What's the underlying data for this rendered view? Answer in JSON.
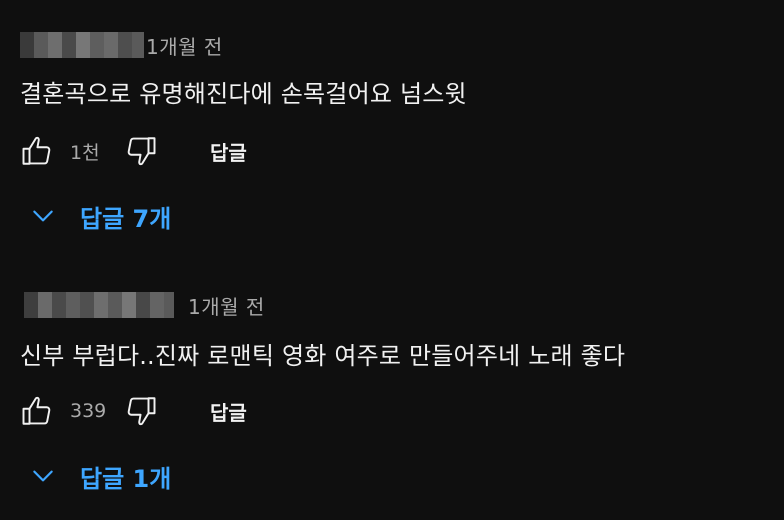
{
  "comments": [
    {
      "author_redacted": true,
      "timestamp": "1개월 전",
      "text": "결혼곡으로 유명해진다에 손목걸어요 넘스윗",
      "like_count": "1천",
      "reply_label": "답글",
      "replies_label": "답글 7개"
    },
    {
      "author_redacted": true,
      "timestamp": "1개월 전",
      "text": "신부 부럽다..진짜 로맨틱 영화 여주로 만들어주네 노래 좋다",
      "like_count": "339",
      "reply_label": "답글",
      "replies_label": "답글 1개"
    }
  ],
  "icons": {
    "like": "thumbs-up-icon",
    "dislike": "thumbs-down-icon",
    "expand": "chevron-down-icon"
  },
  "colors": {
    "background": "#0f0f0f",
    "text_primary": "#f1f1f1",
    "text_secondary": "#aaaaaa",
    "link_blue": "#3ea6ff"
  }
}
